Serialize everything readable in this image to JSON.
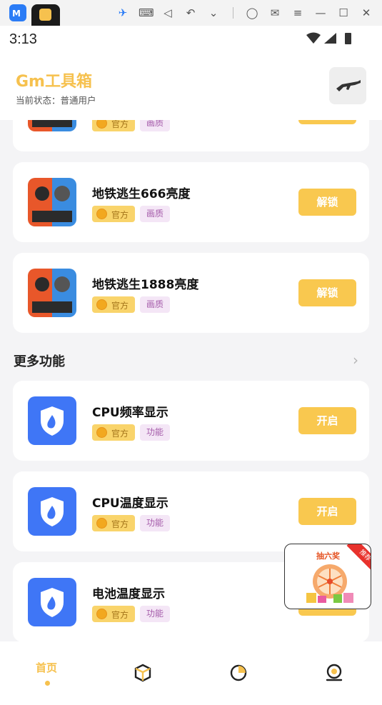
{
  "app": {
    "title": "Gm工具箱",
    "status": "当前状态：普通用户"
  },
  "statusbar": {
    "time": "3:13"
  },
  "tags": {
    "official": "官方"
  },
  "cards_top": [
    {
      "title": "",
      "category": "画质",
      "button": ""
    },
    {
      "title": "地铁逃生666亮度",
      "category": "画质",
      "button": "解锁"
    },
    {
      "title": "地铁逃生1888亮度",
      "category": "画质",
      "button": "解锁"
    }
  ],
  "section": {
    "title": "更多功能",
    "more": "›"
  },
  "cards_more": [
    {
      "title": "CPU频率显示",
      "category": "功能",
      "button": "开启"
    },
    {
      "title": "CPU温度显示",
      "category": "功能",
      "button": "开启"
    },
    {
      "title": "电池温度显示",
      "category": "功能",
      "button": ""
    }
  ],
  "promo": {
    "title": "抽六奖",
    "ribbon": "推荐"
  },
  "nav": {
    "home": "首页"
  },
  "colors": {
    "accent": "#f6c14e",
    "button": "#f9c84f",
    "shield": "#3f76f6"
  }
}
